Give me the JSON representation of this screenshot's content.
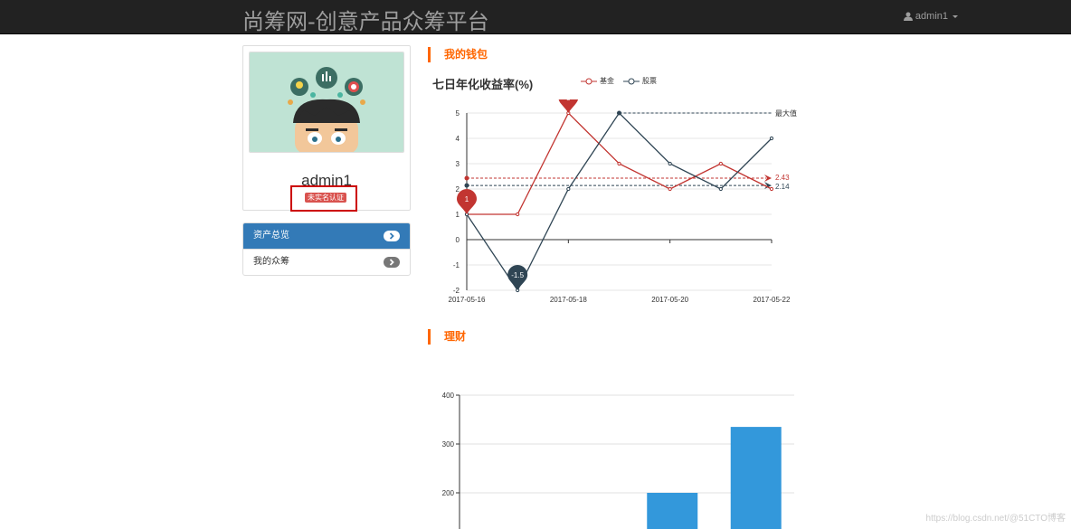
{
  "navbar": {
    "brand": "尚筹网-创意产品众筹平台",
    "user": "admin1",
    "user_icon": "user-icon"
  },
  "profile": {
    "username": "admin1",
    "verify_badge": "未实名认证"
  },
  "side_menu": {
    "items": [
      {
        "label": "资产总览",
        "active": true
      },
      {
        "label": "我的众筹",
        "active": false
      }
    ]
  },
  "sections": {
    "wallet": "我的钱包",
    "finance": "理财"
  },
  "colors": {
    "accent": "#ff6600",
    "fund": "#c23531",
    "stock": "#2f4554",
    "bar": "#3398db"
  },
  "chart_data": [
    {
      "type": "line",
      "title": "七日年化收益率(%)",
      "x": [
        "2017-05-16",
        "2017-05-17",
        "2017-05-18",
        "2017-05-19",
        "2017-05-20",
        "2017-05-21",
        "2017-05-22"
      ],
      "x_tick_labels": [
        "2017-05-16",
        "2017-05-18",
        "2017-05-20",
        "2017-05-22"
      ],
      "ylim": [
        -2,
        5
      ],
      "y_ticks": [
        -2,
        -1,
        0,
        1,
        2,
        3,
        4,
        5
      ],
      "series": [
        {
          "name": "基金",
          "values": [
            1,
            1,
            5,
            3,
            2,
            3,
            2
          ],
          "average": 2.43,
          "average_label": "2.43"
        },
        {
          "name": "股票",
          "values": [
            1,
            -2,
            2,
            5,
            3,
            2,
            4
          ],
          "average": 2.14,
          "average_label": "2.14"
        }
      ],
      "markers": [
        {
          "series": "基金",
          "label": "1",
          "x": "2017-05-16",
          "y": 1
        },
        {
          "series": "基金",
          "label": "5",
          "x": "2017-05-18",
          "y": 5
        },
        {
          "series": "股票",
          "label": "-1.5",
          "x": "2017-05-17",
          "y": -2
        }
      ],
      "max_line_label": "最大值",
      "max_line_value": 5,
      "legend": "top"
    },
    {
      "type": "bar",
      "categories": [
        "",
        "",
        "",
        "",
        ""
      ],
      "values": [
        0,
        0,
        0,
        200,
        335
      ],
      "y_ticks": [
        200,
        300,
        400
      ],
      "ylim": [
        100,
        400
      ]
    }
  ],
  "watermark": "https://blog.csdn.net/@51CTO博客"
}
